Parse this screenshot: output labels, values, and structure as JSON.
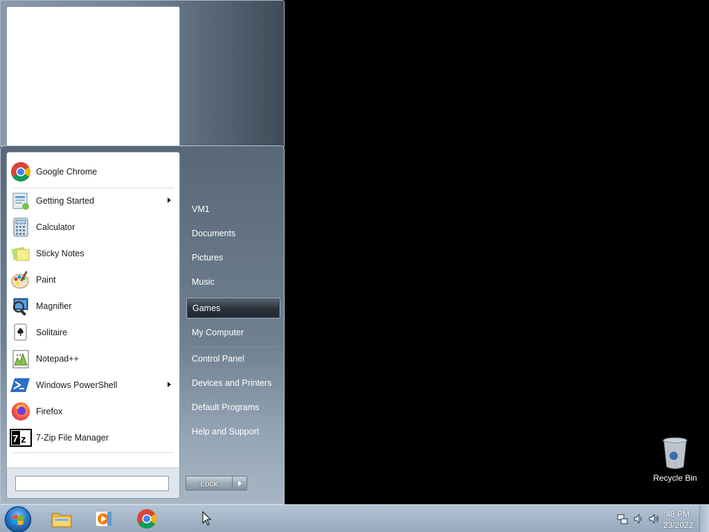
{
  "start_menu": {
    "programs": [
      {
        "label": "Google Chrome",
        "icon": "chrome-icon",
        "submenu": false
      },
      {
        "label": "Getting Started",
        "icon": "getting-started-icon",
        "submenu": true
      },
      {
        "label": "Calculator",
        "icon": "calculator-icon",
        "submenu": false
      },
      {
        "label": "Sticky Notes",
        "icon": "sticky-notes-icon",
        "submenu": false
      },
      {
        "label": "Paint",
        "icon": "paint-icon",
        "submenu": false
      },
      {
        "label": "Magnifier",
        "icon": "magnifier-icon",
        "submenu": false
      },
      {
        "label": "Solitaire",
        "icon": "solitaire-icon",
        "submenu": false
      },
      {
        "label": "Notepad++",
        "icon": "notepad-plus-plus-icon",
        "submenu": false
      },
      {
        "label": "Windows PowerShell",
        "icon": "powershell-icon",
        "submenu": true
      },
      {
        "label": "Firefox",
        "icon": "firefox-icon",
        "submenu": false
      },
      {
        "label": "7-Zip File Manager",
        "icon": "seven-zip-icon",
        "submenu": false
      }
    ],
    "search_value": "",
    "right_items": [
      {
        "label": "VM1"
      },
      {
        "label": "Documents"
      },
      {
        "label": "Pictures"
      },
      {
        "label": "Music"
      },
      {
        "label": "Games",
        "highlighted": true
      },
      {
        "label": "My Computer"
      },
      {
        "label": "Control Panel"
      },
      {
        "label": "Devices and Printers"
      },
      {
        "label": "Default Programs"
      },
      {
        "label": "Help and Support"
      }
    ],
    "lock_label": "Lock"
  },
  "desktop": {
    "recycle_bin_label": "Recycle Bin"
  },
  "taskbar": {
    "pinned": [
      "explorer-icon",
      "media-player-icon",
      "chrome-icon"
    ],
    "clock_time": ":48 PM",
    "clock_date": "23/2022"
  },
  "colors": {
    "accent": "#2b78c9",
    "taskbar": "#a4b6c8",
    "menu_dark": "#596878"
  }
}
